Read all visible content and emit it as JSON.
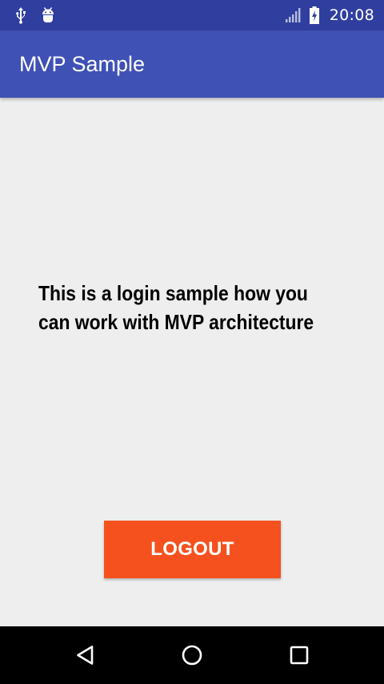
{
  "status_bar": {
    "time": "20:08",
    "icons": [
      "usb-icon",
      "android-debug-icon",
      "signal-icon",
      "battery-charging-icon"
    ]
  },
  "app_bar": {
    "title": "MVP Sample"
  },
  "main": {
    "message": "This is a login sample how you can work with MVP architecture",
    "logout_label": "LOGOUT"
  },
  "nav_bar": {
    "buttons": [
      "back-icon",
      "home-icon",
      "recents-icon"
    ]
  },
  "colors": {
    "status_bar": "#303f9f",
    "app_bar": "#3f51b5",
    "background": "#eeeeee",
    "button": "#f4511e",
    "nav_bar": "#000000"
  }
}
